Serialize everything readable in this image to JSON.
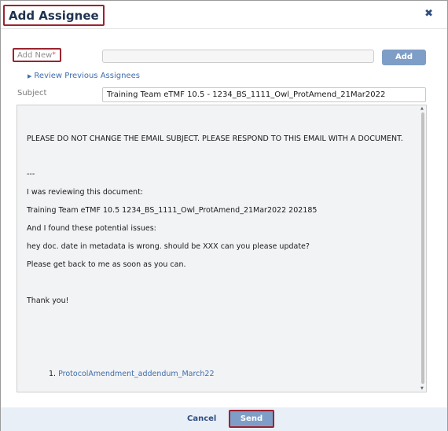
{
  "dialog": {
    "title": "Add Assignee",
    "close_icon": "close-icon",
    "close_glyph": "✖"
  },
  "add_new": {
    "label": "Add New",
    "required_mark": "*",
    "value": "",
    "button_label": "Add"
  },
  "review_link": {
    "icon": "caret-right-icon",
    "glyph": "▶",
    "label": "Review Previous Assignees"
  },
  "subject": {
    "label": "Subject",
    "value": "Training Team eTMF 10.5 - 1234_BS_1111_Owl_ProtAmend_21Mar2022"
  },
  "message": {
    "lines": [
      "PLEASE DO NOT CHANGE THE EMAIL SUBJECT. PLEASE RESPOND TO THIS EMAIL WITH A DOCUMENT.",
      "---",
      "I was reviewing this document:",
      "Training Team eTMF 10.5 1234_BS_1111_Owl_ProtAmend_21Mar2022 202185",
      "And I found these potential issues:",
      "hey doc. date in metadata is wrong. should be XXX can you please update?",
      "Please get back to me as soon as you can.",
      "Thank you!"
    ],
    "attachments": [
      {
        "number": "1.",
        "name": "ProtocolAmendment_addendum_March22"
      }
    ]
  },
  "footer": {
    "cancel_label": "Cancel",
    "send_label": "Send"
  },
  "colors": {
    "accent_button": "#7f9ec7",
    "highlight_border": "#9b2330",
    "link": "#3f6eab",
    "footer_bg": "#e9eff7"
  }
}
